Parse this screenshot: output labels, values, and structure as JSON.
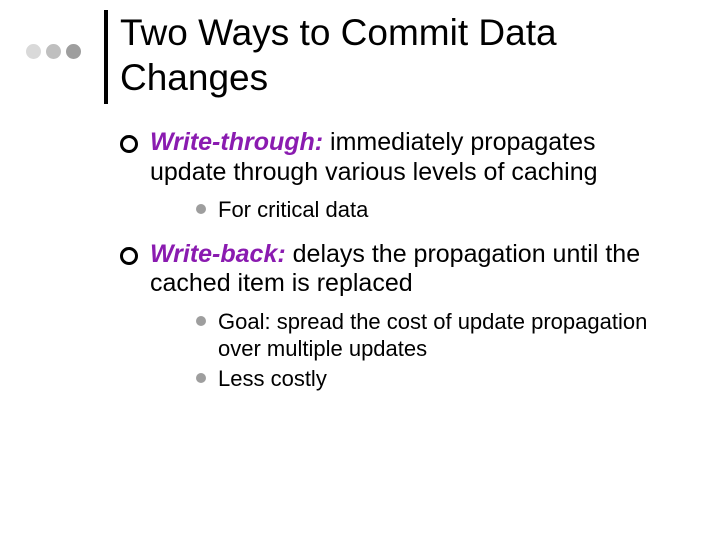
{
  "decor": {
    "dot_colors": [
      "#d9d9d9",
      "#bfbfbf",
      "#9e9e9e"
    ]
  },
  "title": "Two Ways to Commit Data Changes",
  "items": [
    {
      "term": "Write-through:",
      "rest": "  immediately propagates update through various levels of caching",
      "sub": [
        "For critical data"
      ]
    },
    {
      "term": "Write-back:",
      "rest": "  delays the propagation until the cached item is replaced",
      "sub": [
        "Goal:  spread the cost of update propagation over multiple updates",
        "Less costly"
      ]
    }
  ]
}
